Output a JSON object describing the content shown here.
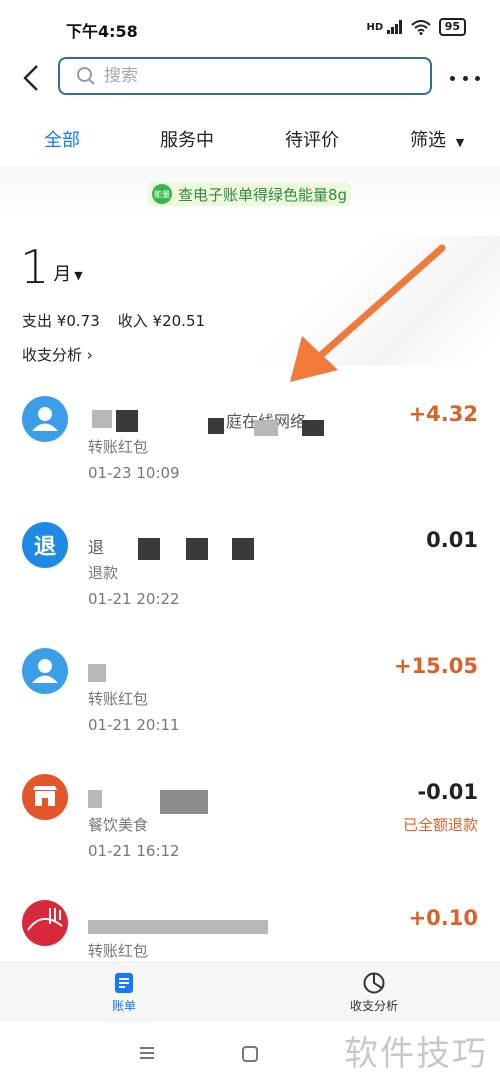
{
  "status_bar": {
    "time": "下午4:58",
    "battery": "95",
    "network": "HD"
  },
  "search": {
    "placeholder": "搜索"
  },
  "tabs": [
    {
      "label": "全部",
      "active": true
    },
    {
      "label": "服务中",
      "active": false
    },
    {
      "label": "待评价",
      "active": false
    },
    {
      "label": "筛选",
      "active": false
    }
  ],
  "banner": {
    "badge": "能量",
    "text": "查电子账单得绿色能量8g"
  },
  "summary": {
    "month": "1",
    "month_unit": "月",
    "expense_label": "支出",
    "expense": "¥0.73",
    "income_label": "收入",
    "income": "¥20.51",
    "analysis_link": "收支分析 ›"
  },
  "transactions": [
    {
      "name_visible": "庭在线网络",
      "category": "转账红包",
      "time": "01-23  10:09",
      "amount": "+4.32",
      "type": "income",
      "avatar_icon": "person-icon"
    },
    {
      "name_visible": "退",
      "category": "退款",
      "time": "01-21  20:22",
      "amount": "0.01",
      "type": "neutral",
      "avatar_icon": "refund-icon",
      "avatar_text": "退"
    },
    {
      "name_visible": "",
      "category": "转账红包",
      "time": "01-21  20:11",
      "amount": "+15.05",
      "type": "income",
      "avatar_icon": "person-icon"
    },
    {
      "name_visible": "",
      "category": "餐饮美食",
      "time": "01-21  16:12",
      "amount": "-0.01",
      "type": "expense",
      "note": "已全额退款",
      "avatar_icon": "shop-icon"
    },
    {
      "name_visible": "",
      "category": "转账红包",
      "time": "",
      "amount": "+0.10",
      "type": "income",
      "avatar_icon": "photo-avatar"
    }
  ],
  "bottom_nav": [
    {
      "label": "账单",
      "icon": "bill-icon",
      "active": true
    },
    {
      "label": "收支分析",
      "icon": "pie-chart-icon",
      "active": false
    }
  ],
  "watermark": "软件技巧",
  "colors": {
    "accent": "#1677ff",
    "income": "#d9622b",
    "search_border": "#2d6f99",
    "avatar_blue": "#3a9ee8",
    "shop_orange": "#e2562a",
    "banner_green": "#2e8b45",
    "arrow": "#f07a3a"
  }
}
